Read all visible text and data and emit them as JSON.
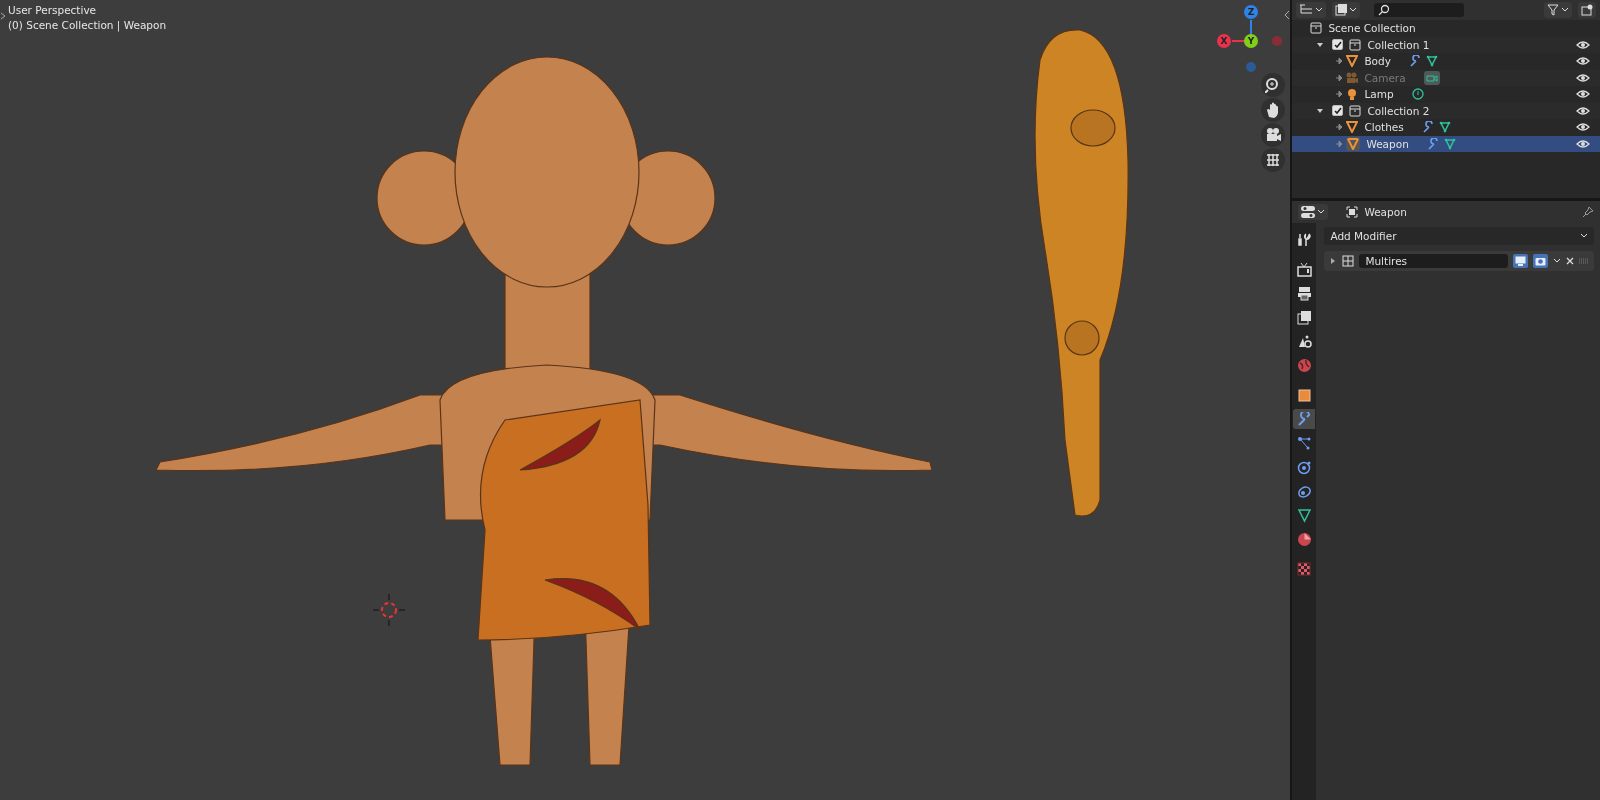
{
  "viewport": {
    "view_name": "User Perspective",
    "scene_info": "(0) Scene Collection | Weapon",
    "gizmo_axes": [
      {
        "label": "Z",
        "color": "#2f83e8"
      },
      {
        "label": "X",
        "color": "#e8324b"
      },
      {
        "label": "Y",
        "color": "#80d01a"
      }
    ]
  },
  "outliner": {
    "root": "Scene Collection",
    "collections": [
      {
        "label": "Collection 1",
        "checked": true,
        "expanded": true,
        "children": [
          {
            "label": "Body",
            "kind": "mesh",
            "disabled": false,
            "selected": false
          },
          {
            "label": "Camera",
            "kind": "camera",
            "disabled": true,
            "selected": false
          },
          {
            "label": "Lamp",
            "kind": "light",
            "disabled": false,
            "selected": false
          }
        ]
      },
      {
        "label": "Collection 2",
        "checked": true,
        "expanded": true,
        "children": [
          {
            "label": "Clothes",
            "kind": "mesh",
            "disabled": false,
            "selected": false
          },
          {
            "label": "Weapon",
            "kind": "mesh",
            "disabled": false,
            "selected": true
          }
        ]
      }
    ]
  },
  "properties": {
    "object_name": "Weapon",
    "add_button": "Add Modifier",
    "tabs": [
      {
        "kind": "tool",
        "selected": false
      },
      {
        "kind": "render",
        "selected": false
      },
      {
        "kind": "output",
        "selected": false
      },
      {
        "kind": "view_layer",
        "selected": false
      },
      {
        "kind": "scene",
        "selected": false
      },
      {
        "kind": "world",
        "selected": false
      },
      {
        "kind": "object",
        "selected": false
      },
      {
        "kind": "modifier",
        "selected": true
      },
      {
        "kind": "particles",
        "selected": false
      },
      {
        "kind": "physics",
        "selected": false
      },
      {
        "kind": "constraints",
        "selected": false
      },
      {
        "kind": "data",
        "selected": false
      },
      {
        "kind": "material",
        "selected": false
      },
      {
        "kind": "texture",
        "selected": false
      }
    ],
    "modifiers": [
      {
        "name": "Multires",
        "expanded": false,
        "show_viewport": true,
        "show_render": true
      }
    ]
  }
}
